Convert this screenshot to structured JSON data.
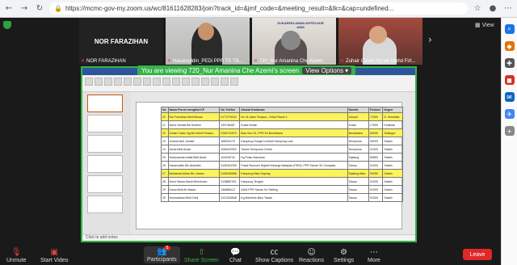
{
  "browser": {
    "url": "https://mcmc-gov-my.zoom.us/wc/81611628283/join?track_id=&jmf_code=&meeting_result=&tk=&cap=undefined..."
  },
  "zoom": {
    "view_label": "View",
    "participants_strip": [
      {
        "name": "NOR FARAZIHAN",
        "caption": "NOR FARAZIHAN",
        "video": false
      },
      {
        "name": "",
        "caption": "Hasanuddin_PEDi PPR TS Titi...",
        "video": true
      },
      {
        "name": "",
        "caption": "720_Nur Amanina Che Azemi",
        "video": true,
        "sign_text": "SUKAREELAWAN MYPDI NUR ANIS"
      },
      {
        "name": "",
        "caption": "Zuhair Calvin Ng bin Mohd Firt...",
        "video": true
      }
    ],
    "banner": {
      "text": "You are viewing 720_Nur Amanina Che Azemi's screen",
      "view_options": "View Options"
    },
    "presentation": {
      "headers": [
        "No",
        "Nama Penuh mengikut KP",
        "No Telefon",
        "Alamat Kediaman",
        "Daerah",
        "Poskod",
        "Negeri"
      ],
      "rows": [
        {
          "hl": true,
          "cells": [
            "20",
            "Nur Farzaihan Binti Ikhsan",
            "0177276242",
            "No 44 Jalan Tempua , Felda Pasoh 1",
            "Jempol",
            "72300",
            "N. Sembilan"
          ]
        },
        {
          "hl": false,
          "cells": [
            "21",
            "Mohd Jeshak Bin Ibrahim",
            "199748487",
            "Kuala Kedah",
            "Kuala",
            "17600",
            "Kelantan"
          ]
        },
        {
          "hl": true,
          "cells": [
            "22",
            "Zuhair Calvin Ng Bin Mohd Firdaus",
            "0169741573",
            "Blok Surf 24, PPR Sri Bendahara",
            "Bendahara",
            "83030",
            "Selangor"
          ]
        },
        {
          "hl": false,
          "cells": [
            "23",
            "Juliana binti Jumatri",
            "168334170",
            "Kampung Sungai Lembah Kampung Laut",
            "Sempoma",
            "90000",
            "Sabah"
          ]
        },
        {
          "hl": false,
          "cells": [
            "24",
            "Asma Binti Arsad",
            "1098422992",
            "Taman Sempoma Centre",
            "Sempoma",
            "91300",
            "Sabah"
          ]
        },
        {
          "hl": false,
          "cells": [
            "25",
            "Noreyuanda Ardila Binti Afrad",
            "104028742",
            "Kg Pulau Manukan",
            "Sipitang",
            "89850",
            "Sabah"
          ]
        },
        {
          "hl": false,
          "cells": [
            "26",
            "Hasanuddin Bin Abdullah",
            "0135444339",
            "Pusat Ekonomi Digital Keluarga Malaysia (PEDi), PPR Taman Sri Cempaka",
            "Tawau",
            "91000",
            "Sabah"
          ]
        },
        {
          "hl": true,
          "cells": [
            "27",
            "Mohamad Akbar Bin Jaman",
            "0136036558",
            "Kampung Batu Sapong",
            "Sipitang Batu",
            "90250",
            "Sabah"
          ]
        },
        {
          "hl": false,
          "cells": [
            "28",
            "Nurul Sasha Sandi Binti Aman",
            "0138887921",
            "Kampung Tengah",
            "Tawau",
            "91000",
            "Sabah"
          ]
        },
        {
          "hl": false,
          "cells": [
            "29",
            "Karsa Binti Ah Bakah",
            "136688412",
            "ADW PPR Taman Sri Setiling",
            "Tawau",
            "91000",
            "Sabah"
          ]
        },
        {
          "hl": false,
          "cells": [
            "30",
            "Nurmadiana Binti Cheli",
            "0121254848",
            "Kg Memeluk Baru Tawau",
            "Tawau",
            "91000",
            "Sabah"
          ]
        }
      ],
      "notes_hint": "Click to add notes"
    },
    "toolbar": {
      "unmute": "Unmute",
      "start_video": "Start Video",
      "participants": "Participants",
      "participants_count": "5",
      "share_screen": "Share Screen",
      "chat": "Chat",
      "show_captions": "Show Captions",
      "reactions": "Reactions",
      "settings": "Settings",
      "more": "More",
      "leave": "Leave"
    }
  }
}
